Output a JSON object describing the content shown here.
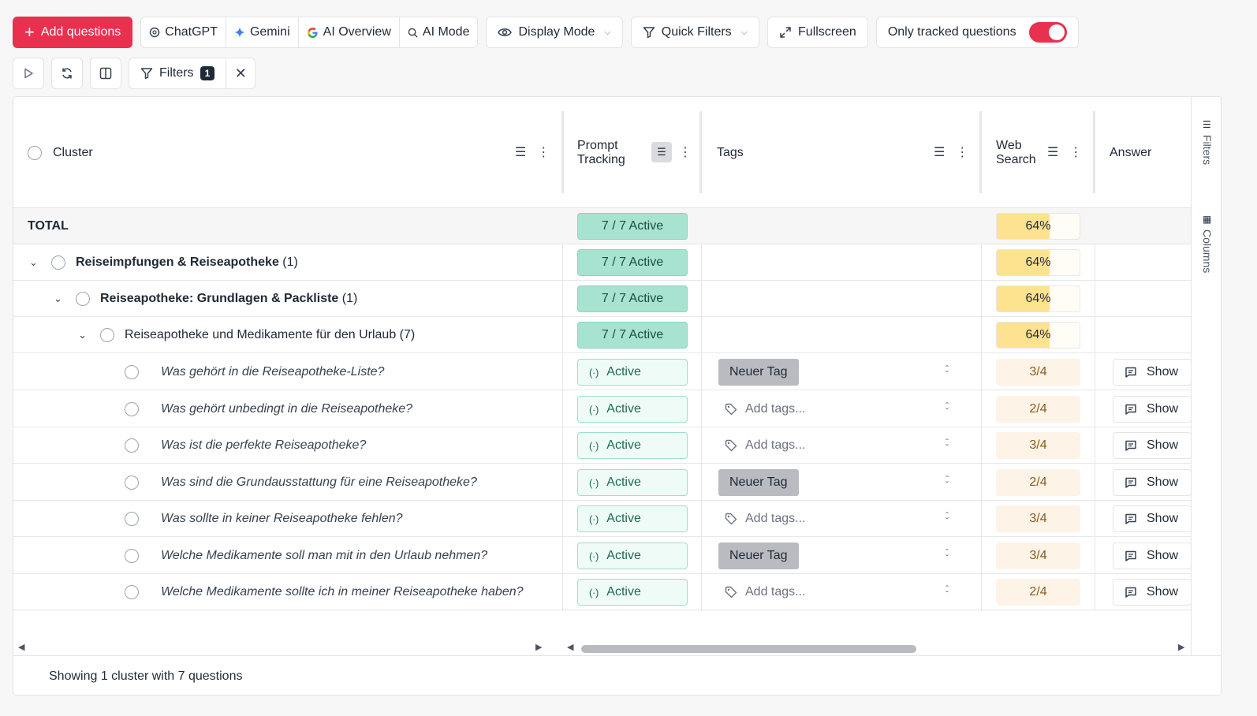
{
  "toolbar": {
    "add_questions": "Add questions",
    "chatgpt": "ChatGPT",
    "gemini": "Gemini",
    "ai_overview": "AI Overview",
    "ai_mode": "AI Mode",
    "display_mode": "Display Mode",
    "quick_filters": "Quick Filters",
    "fullscreen": "Fullscreen",
    "only_tracked": "Only tracked questions",
    "only_tracked_on": true,
    "accent_color": "#e8304f"
  },
  "toolbar2": {
    "filters_label": "Filters",
    "filters_count": "1"
  },
  "columns": {
    "cluster": "Cluster",
    "prompt_tracking_1": "Prompt",
    "prompt_tracking_2": "Tracking",
    "tags": "Tags",
    "web_search_1": "Web",
    "web_search_2": "Search",
    "answer": "Answer"
  },
  "total_row": {
    "label": "TOTAL",
    "tracking": "7 / 7 Active",
    "web": "64%"
  },
  "groups": [
    {
      "name": "Reiseimpfungen & Reiseapotheke",
      "count": "(1)",
      "tracking": "7 / 7 Active",
      "web": "64%"
    },
    {
      "name": "Reiseapotheke: Grundlagen & Packliste",
      "count": "(1)",
      "tracking": "7 / 7 Active",
      "web": "64%"
    },
    {
      "name": "Reiseapotheke und Medikamente für den Urlaub",
      "count": "(7)",
      "tracking": "7 / 7 Active",
      "web": "64%"
    }
  ],
  "questions": [
    {
      "text": "Was gehört in die Reiseapotheke-Liste?",
      "status": "Active",
      "tag": "Neuer Tag",
      "web": "3/4",
      "answer": "Show"
    },
    {
      "text": "Was gehört unbedingt in die Reiseapotheke?",
      "status": "Active",
      "tag": "Add tags...",
      "web": "2/4",
      "answer": "Show"
    },
    {
      "text": "Was ist die perfekte Reiseapotheke?",
      "status": "Active",
      "tag": "Add tags...",
      "web": "3/4",
      "answer": "Show"
    },
    {
      "text": "Was sind die Grundausstattung für eine Reiseapotheke?",
      "status": "Active",
      "tag": "Neuer Tag",
      "web": "2/4",
      "answer": "Show"
    },
    {
      "text": "Was sollte in keiner Reiseapotheke fehlen?",
      "status": "Active",
      "tag": "Add tags...",
      "web": "3/4",
      "answer": "Show"
    },
    {
      "text": "Welche Medikamente soll man mit in den Urlaub nehmen?",
      "status": "Active",
      "tag": "Neuer Tag",
      "web": "3/4",
      "answer": "Show"
    },
    {
      "text": "Welche Medikamente sollte ich in meiner Reiseapotheke haben?",
      "status": "Active",
      "tag": "Add tags...",
      "web": "2/4",
      "answer": "Show"
    }
  ],
  "side_panel": {
    "filters": "Filters",
    "columns": "Columns"
  },
  "footer": {
    "summary": "Showing 1 cluster with 7 questions"
  }
}
